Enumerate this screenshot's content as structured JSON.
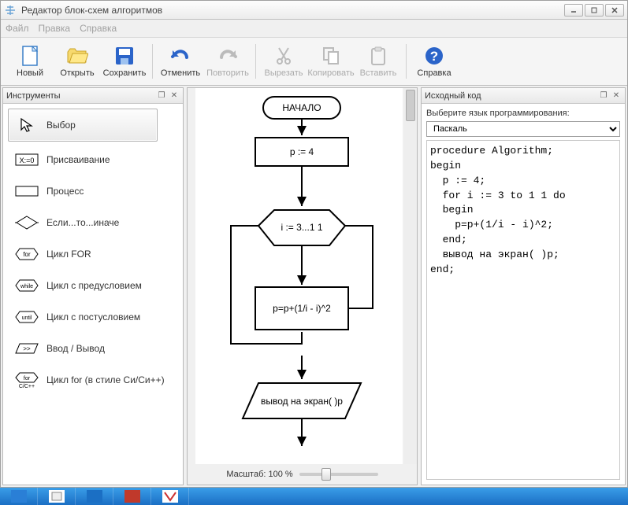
{
  "window": {
    "title": "Редактор блок-схем алгоритмов"
  },
  "menu": {
    "file": "Файл",
    "edit": "Правка",
    "help": "Справка"
  },
  "toolbar": {
    "new": "Новый",
    "open": "Открыть",
    "save": "Сохранить",
    "undo": "Отменить",
    "redo": "Повторить",
    "cut": "Вырезать",
    "copy": "Копировать",
    "paste": "Вставить",
    "help": "Справка"
  },
  "panels": {
    "tools_title": "Инструменты",
    "source_title": "Исходный код"
  },
  "tools": {
    "select": "Выбор",
    "assign": "Присваивание",
    "process": "Процесс",
    "ifelse": "Если...то...иначе",
    "for": "Цикл FOR",
    "while": "Цикл с предусловием",
    "until": "Цикл с постусловием",
    "io": "Ввод / Вывод",
    "cfor": "Цикл for (в стиле Си/Си++)"
  },
  "flowchart": {
    "start": "НАЧАЛО",
    "assign": "p := 4",
    "loop": "i := 3...1 1",
    "body": "p=p+(1/i - i)^2",
    "output": "вывод на экран( )p"
  },
  "zoom": {
    "label": "Масштаб: 100 %"
  },
  "source": {
    "lang_label": "Выберите язык программирования:",
    "lang_selected": "Паскаль",
    "code": "procedure Algorithm;\nbegin\n  p := 4;\n  for i := 3 to 1 1 do\n  begin\n    p=p+(1/i - i)^2;\n  end;\n  вывод на экран( )p;\nend;"
  },
  "chart_data": {
    "type": "flowchart",
    "nodes": [
      {
        "id": "start",
        "kind": "terminal",
        "label": "НАЧАЛО"
      },
      {
        "id": "assign",
        "kind": "process",
        "label": "p := 4"
      },
      {
        "id": "loop",
        "kind": "loop-hexagon",
        "label": "i := 3...1 1"
      },
      {
        "id": "body",
        "kind": "process",
        "label": "p=p+(1/i - i)^2"
      },
      {
        "id": "output",
        "kind": "io-parallelogram",
        "label": "вывод на экран( )p"
      }
    ],
    "edges": [
      {
        "from": "start",
        "to": "assign"
      },
      {
        "from": "assign",
        "to": "loop"
      },
      {
        "from": "loop",
        "to": "body"
      },
      {
        "from": "body",
        "to": "loop",
        "kind": "back"
      },
      {
        "from": "loop",
        "to": "output",
        "kind": "exit"
      }
    ]
  }
}
